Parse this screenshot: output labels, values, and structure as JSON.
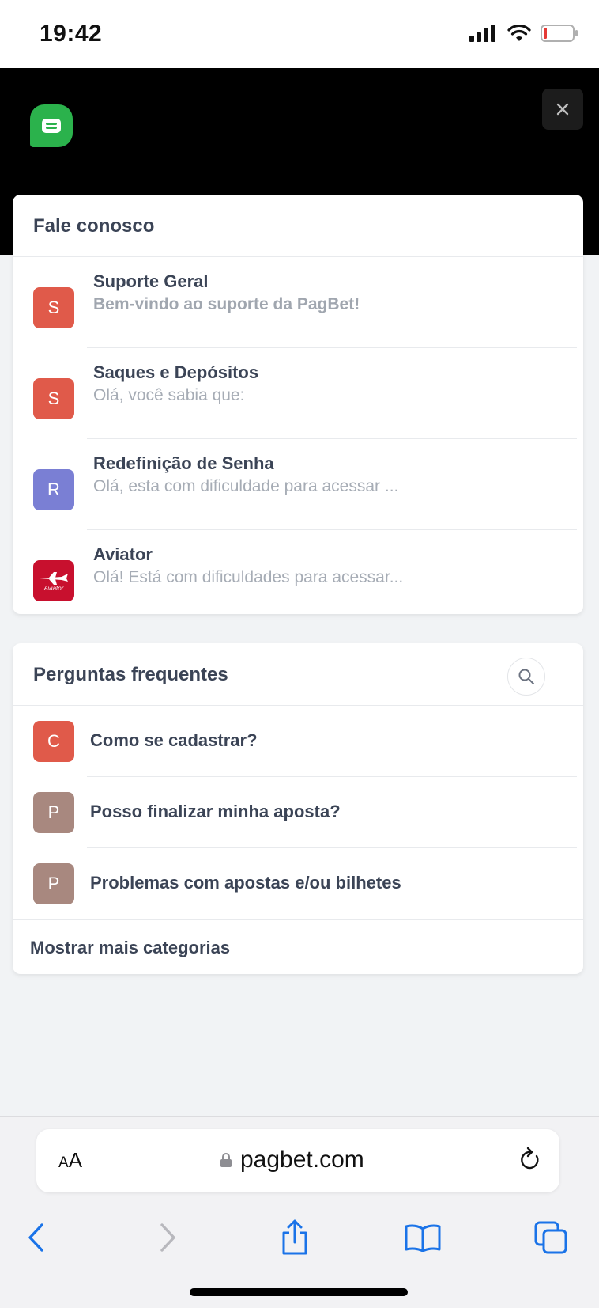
{
  "status_bar": {
    "time": "19:42"
  },
  "header": {
    "brand_color": "#2bb24c"
  },
  "contact": {
    "title": "Fale conosco",
    "chats": [
      {
        "initial": "S",
        "color": "#e05a4a",
        "title": "Suporte Geral",
        "subtitle": "Bem-vindo ao suporte da PagBet!"
      },
      {
        "initial": "S",
        "color": "#e05a4a",
        "title": "Saques e Depósitos",
        "subtitle": "Olá, você sabia que:"
      },
      {
        "initial": "R",
        "color": "#7a7fd4",
        "title": "Redefinição de Senha",
        "subtitle": "Olá, esta com dificuldade para acessar ..."
      },
      {
        "initial": "",
        "icon_text": "Aviator",
        "color": "#c8102e",
        "title": "Aviator",
        "subtitle": "Olá! Está com dificuldades para acessar..."
      }
    ]
  },
  "faq": {
    "title": "Perguntas frequentes",
    "items": [
      {
        "initial": "C",
        "color": "#e05a4a",
        "label": "Como se cadastrar?"
      },
      {
        "initial": "P",
        "color": "#a8887f",
        "label": "Posso finalizar minha aposta?"
      },
      {
        "initial": "P",
        "color": "#a8887f",
        "label": "Problemas com apostas e/ou bilhetes"
      }
    ],
    "more_label": "Mostrar mais categorias"
  },
  "browser": {
    "aa_large": "A",
    "aa_small": "A",
    "url": "pagbet.com"
  }
}
